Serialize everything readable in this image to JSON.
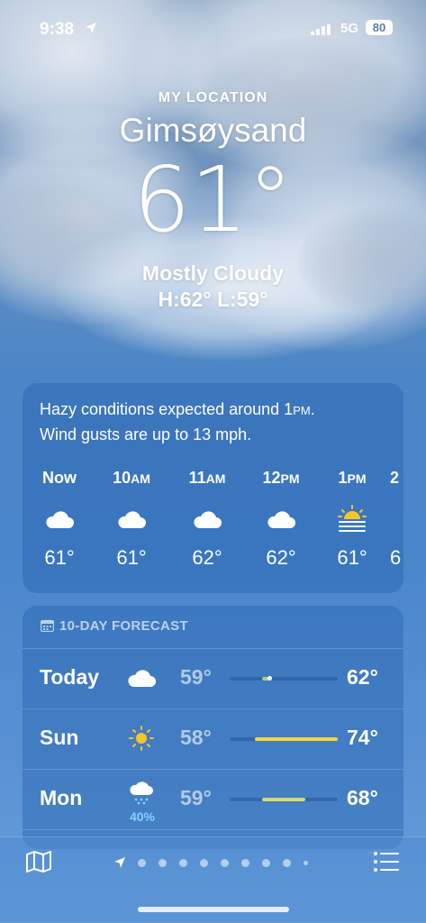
{
  "status_bar": {
    "time": "9:38",
    "network": "5G",
    "battery": "80"
  },
  "header": {
    "subtitle": "MY LOCATION",
    "city": "Gimsøysand",
    "temperature": "61°",
    "condition": "Mostly Cloudy",
    "high_low": "H:62°  L:59°"
  },
  "hourly": {
    "summary_line1": "Hazy conditions expected around 1",
    "summary_pm": "PM",
    "summary_line1_end": ".",
    "summary_line2": "Wind gusts are up to 13 mph.",
    "hours": [
      {
        "label": "Now",
        "suffix": "",
        "icon": "cloud-icon",
        "temp": "61°"
      },
      {
        "label": "10",
        "suffix": "AM",
        "icon": "cloud-icon",
        "temp": "61°"
      },
      {
        "label": "11",
        "suffix": "AM",
        "icon": "cloud-icon",
        "temp": "62°"
      },
      {
        "label": "12",
        "suffix": "PM",
        "icon": "cloud-icon",
        "temp": "62°"
      },
      {
        "label": "1",
        "suffix": "PM",
        "icon": "haze-sun-icon",
        "temp": "61°"
      },
      {
        "label": "2",
        "suffix": "",
        "icon": "cloud-icon",
        "temp": "6"
      }
    ]
  },
  "daily": {
    "title": "10-DAY FORECAST",
    "days": [
      {
        "day": "Today",
        "icon": "cloud-icon",
        "precip": "",
        "low": "59°",
        "high": "62°",
        "range_start": 0.3,
        "range_end": 0.38,
        "color": "#a6d86a"
      },
      {
        "day": "Sun",
        "icon": "sun-icon",
        "precip": "",
        "low": "58°",
        "high": "74°",
        "range_start": 0.23,
        "range_end": 1.0,
        "color": "#f3d63b"
      },
      {
        "day": "Mon",
        "icon": "rain-cloud-icon",
        "precip": "40%",
        "low": "59°",
        "high": "68°",
        "range_start": 0.3,
        "range_end": 0.7,
        "color": "#d9d96a"
      }
    ]
  },
  "tab_bar": {
    "page_count": 10
  }
}
